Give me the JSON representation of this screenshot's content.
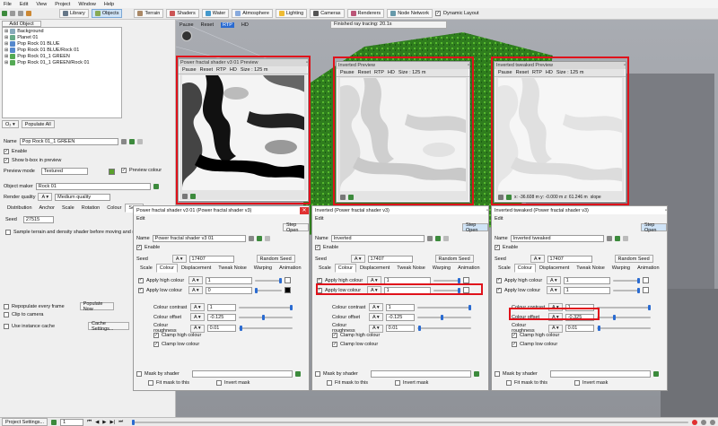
{
  "menu": [
    "File",
    "Edit",
    "View",
    "Project",
    "Window",
    "Help"
  ],
  "toolbar": {
    "add_object": "Add Object",
    "library": "Library",
    "objects": "Objects",
    "terrain": "Terrain",
    "shaders": "Shaders",
    "water": "Water",
    "atmosphere": "Atmosphere",
    "lighting": "Lighting",
    "cameras": "Cameras",
    "renderers": "Renderers",
    "node_network": "Node Network",
    "dynamic_layout": "Dynamic Layout"
  },
  "viewport_toolbar": {
    "pause": "Pause",
    "reset": "Reset",
    "rtp": "RTP",
    "hd": "HD",
    "status": "Finished ray tracing: 20.1s"
  },
  "tree": {
    "items": [
      "Background",
      "Planet 01",
      "Pop Rock 01 BLUE",
      "Pop Rock 01 BLUE/Rock 01",
      "Pop Rock 01_1 GREEN",
      "Pop Rock 01_1 GREEN/Rock 01"
    ],
    "populate_all": "Populate All"
  },
  "props": {
    "name_label": "Name",
    "name_value": "Pop Rock 01_1 GREEN",
    "enable": "Enable",
    "show_bbox": "Show b-box in preview",
    "preview_mode_label": "Preview mode",
    "preview_mode_value": "Textured",
    "preview_colour": "Preview colour",
    "object_maker_label": "Object maker",
    "object_maker_value": "Rock 01",
    "render_quality_label": "Render quality",
    "render_quality_value": "Medium quality",
    "tabs": [
      "Distribution",
      "Anchor",
      "Scale",
      "Rotation",
      "Colour",
      "Seed"
    ],
    "seed_label": "Seed",
    "seed_value": "27515",
    "sample_terrain": "Sample terrain and density shader before moving and rotating",
    "repopulate": "Repopulate every frame",
    "populate_now": "Populate Now",
    "clip_camera": "Clip to camera",
    "use_instance_cache": "Use instance cache",
    "cache_settings": "Cache Settings..."
  },
  "previews": [
    {
      "title": "Power fractal shader v3 01 Preview",
      "pause": "Pause",
      "reset": "Reset",
      "rtp": "RTP",
      "hd": "HD",
      "size": "Size : 125 m"
    },
    {
      "title": "Inverted Preview",
      "pause": "Pause",
      "reset": "Reset",
      "rtp": "RTP",
      "hd": "HD",
      "size": "Size : 125 m"
    },
    {
      "title": "Inverted tweaked Preview",
      "pause": "Pause",
      "reset": "Reset",
      "rtp": "RTP",
      "hd": "HD",
      "size": "Size : 125 m",
      "coords": "x: -36.608 m   y: -0.000 m   z: 61.246 m",
      "slope": "slope"
    }
  ],
  "editors": [
    {
      "title": "Power fractal shader v3 01   (Power fractal shader v3)",
      "menu": "Edit",
      "step_open": "Step Open",
      "name_label": "Name",
      "name_value": "Power fractal shader v3 01",
      "enable": "Enable",
      "seed_label": "Seed",
      "seed_value": "17407",
      "random_seed": "Random Seed",
      "tabs": [
        "Scale",
        "Colour",
        "Displacement",
        "Tweak Noise",
        "Warping",
        "Animation"
      ],
      "apply_high": "Apply high colour",
      "high_value": "1",
      "apply_low": "Apply low colour",
      "low_value": "0",
      "contrast_label": "Colour contrast",
      "contrast_value": "1",
      "offset_label": "Colour offset",
      "offset_value": "-0.125",
      "roughness_label": "Colour roughness",
      "roughness_value": "0.01",
      "clamp_high": "Clamp high colour",
      "clamp_low": "Clamp low colour",
      "mask_by_shader": "Mask by shader",
      "fit_mask": "Fit mask to this",
      "invert_mask": "Invert mask"
    },
    {
      "title": "Inverted   (Power fractal shader v3)",
      "menu": "Edit",
      "step_open": "Step Open",
      "name_label": "Name",
      "name_value": "Inverted",
      "enable": "Enable",
      "seed_label": "Seed",
      "seed_value": "17407",
      "random_seed": "Random Seed",
      "tabs": [
        "Scale",
        "Colour",
        "Displacement",
        "Tweak Noise",
        "Warping",
        "Animation"
      ],
      "apply_high": "Apply high colour",
      "high_value": "1",
      "apply_low": "Apply low colour",
      "low_value": "1",
      "contrast_label": "Colour contrast",
      "contrast_value": "1",
      "offset_label": "Colour offset",
      "offset_value": "-0.125",
      "roughness_label": "Colour roughness",
      "roughness_value": "0.01",
      "clamp_high": "Clamp high colour",
      "clamp_low": "Clamp low colour",
      "mask_by_shader": "Mask by shader",
      "fit_mask": "Fit mask to this",
      "invert_mask": "Invert mask"
    },
    {
      "title": "Inverted tweaked   (Power fractal shader v3)",
      "menu": "Edit",
      "step_open": "Step Open",
      "name_label": "Name",
      "name_value": "Inverted tweaked",
      "enable": "Enable",
      "seed_label": "Seed",
      "seed_value": "17407",
      "random_seed": "Random Seed",
      "tabs": [
        "Scale",
        "Colour",
        "Displacement",
        "Tweak Noise",
        "Warping",
        "Animation"
      ],
      "apply_high": "Apply high colour",
      "high_value": "1",
      "apply_low": "Apply low colour",
      "low_value": "1",
      "contrast_label": "Colour contrast",
      "contrast_value": "1",
      "offset_label": "Colour offset",
      "offset_value": "-0.325",
      "roughness_label": "Colour roughness",
      "roughness_value": "0.01",
      "clamp_high": "Clamp high colour",
      "clamp_low": "Clamp low colour",
      "mask_by_shader": "Mask by shader",
      "fit_mask": "Fit mask to this",
      "invert_mask": "Invert mask"
    }
  ],
  "statusbar": {
    "project_settings": "Project Settings...",
    "frame": "1"
  },
  "colors": {
    "highlight": "#e0121b",
    "accent": "#2a6bd1"
  }
}
